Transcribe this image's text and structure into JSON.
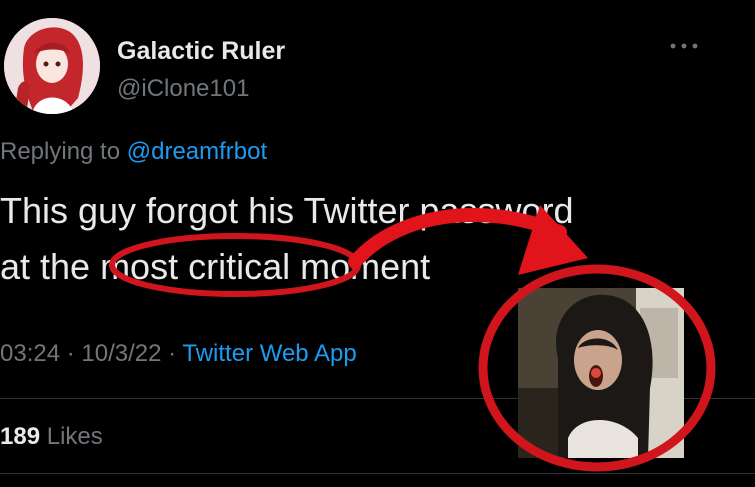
{
  "tweet": {
    "author": {
      "display_name": "Galactic Ruler",
      "handle": "@iClone101",
      "avatar_icon": "anime-avatar-image"
    },
    "more_icon": "more-dots-icon",
    "replying_prefix": "Replying to",
    "replying_to": "@dreamfrbot",
    "text_line1": "This guy forgot his Twitter password",
    "text_line2": "at the most critical moment",
    "time": "03:24",
    "date": "10/3/22",
    "separator": "·",
    "source": "Twitter Web App",
    "likes_count": "189",
    "likes_label": "Likes"
  },
  "annotation": {
    "circle_color": "#d0161c",
    "arrow_color": "#e0141a",
    "webcam_icon": "shocked-streamer-webcam-image"
  }
}
